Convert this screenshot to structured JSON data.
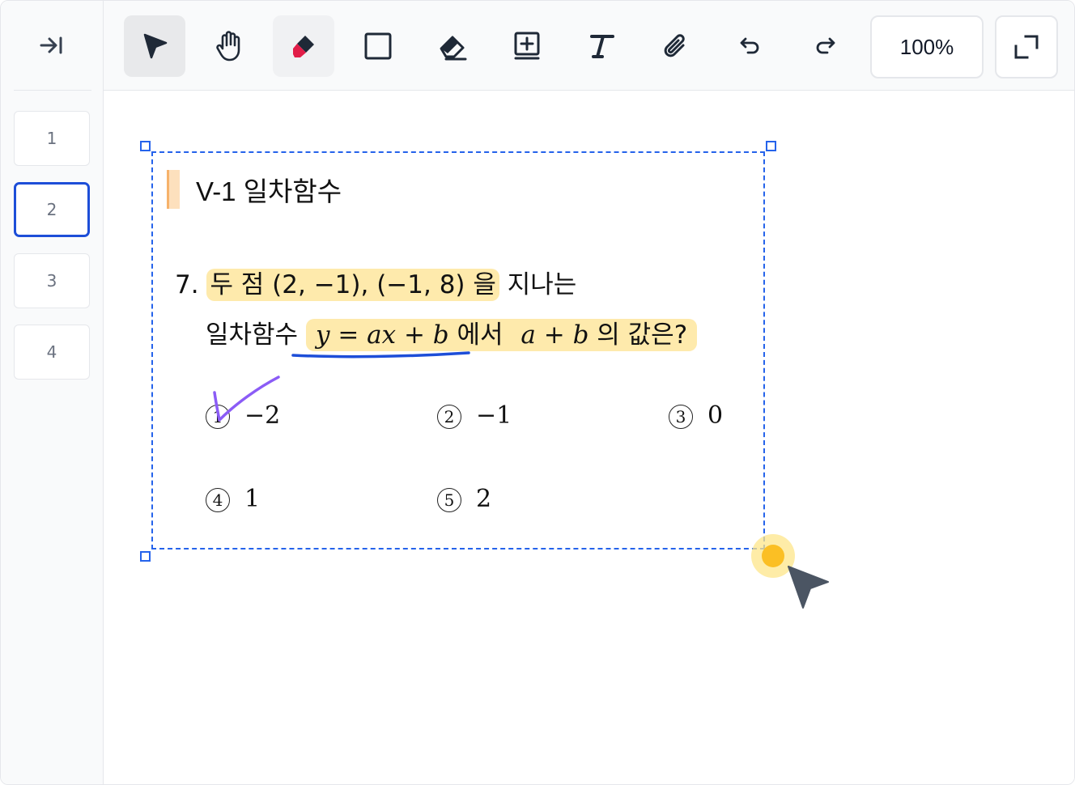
{
  "sidebar": {
    "collapse_icon": "collapse-right-icon",
    "pages": [
      "1",
      "2",
      "3",
      "4"
    ],
    "active_page": "2"
  },
  "toolbar": {
    "tools": [
      "select-arrow-icon",
      "hand-icon",
      "pen-marker-icon",
      "rectangle-icon",
      "eraser-icon",
      "add-box-icon",
      "text-icon",
      "attach-icon",
      "undo-icon",
      "redo-icon"
    ],
    "zoom": "100%",
    "expand_icon": "expand-icon"
  },
  "document": {
    "section_title": "V-1 일차함수",
    "question_number": "7.",
    "line1_highlight": "두 점 (2, −1), (−1, 8) 을",
    "line1_rest": "지나는",
    "line2_prefix": "일차함수",
    "line2_formula": "y = ax + b",
    "line2_middle": "에서",
    "line2_expr": "a + b",
    "line2_suffix": "의 값은?",
    "choices": [
      {
        "num": "1",
        "value": "−2"
      },
      {
        "num": "2",
        "value": "−1"
      },
      {
        "num": "3",
        "value": "0"
      },
      {
        "num": "4",
        "value": "1"
      },
      {
        "num": "5",
        "value": "2"
      }
    ]
  },
  "colors": {
    "selection": "#2563eb",
    "highlight": "#fdd868",
    "underline": "#1d4ed8",
    "checkmark": "#8b5cf6",
    "cursor": "#4b5563",
    "cursor_dot": "#fbbf24"
  }
}
